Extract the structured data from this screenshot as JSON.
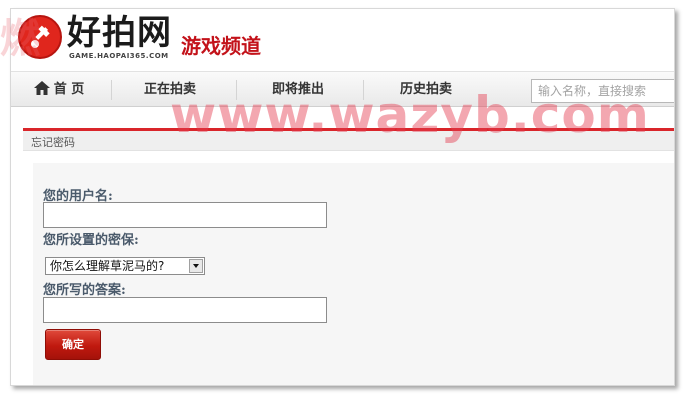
{
  "logo": {
    "name": "好拍网",
    "domain": "GAME.HAOPAI365.COM",
    "channel": "游戏频道"
  },
  "nav": {
    "home": "首 页",
    "items": [
      "正在拍卖",
      "即将推出",
      "历史拍卖"
    ],
    "search_placeholder": "输入名称，直接搜索"
  },
  "section": {
    "title": "忘记密码"
  },
  "form": {
    "username_label": "您的用户名:",
    "username_value": "",
    "question_label": "您所设置的密保:",
    "question_selected": "你怎么理解草泥马的?",
    "answer_label": "您所写的答案:",
    "answer_value": "",
    "submit_label": "确定"
  },
  "watermark": {
    "text_left": "燃",
    "url": "www.wazyb.com"
  },
  "colors": {
    "accent_red": "#d9252a",
    "button_red": "#c0190f",
    "label_text": "#4a5a6b"
  }
}
